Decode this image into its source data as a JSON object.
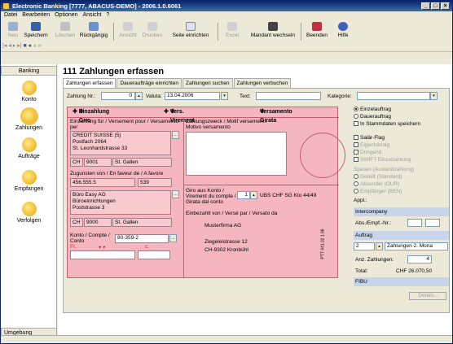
{
  "window": {
    "title": "Electronic Banking [7777, ABACUS-DEMO] - 2006.1.0.6061"
  },
  "menu": [
    "Datei",
    "Bearbeiten",
    "Optionen",
    "Ansicht",
    "?"
  ],
  "toolbar": [
    {
      "label": "Neu",
      "enabled": false
    },
    {
      "label": "Speichern",
      "enabled": true
    },
    {
      "label": "Löschen",
      "enabled": false
    },
    {
      "label": "Rückgängig",
      "enabled": true
    },
    {
      "label": "Ansicht",
      "enabled": false
    },
    {
      "label": "Drucken",
      "enabled": false
    },
    {
      "label": "Seite einrichten",
      "enabled": true
    },
    {
      "label": "Excel",
      "enabled": false
    },
    {
      "label": "Mandant wechseln",
      "enabled": true
    },
    {
      "label": "Beenden",
      "enabled": true
    },
    {
      "label": "Hilfe",
      "enabled": true
    }
  ],
  "sidebar": {
    "header": "Banking",
    "items": [
      "Konto",
      "Zahlungen",
      "Aufträge",
      "Empfangen",
      "Verfolgen"
    ],
    "selected": "Zahlungen",
    "footer": "Umgebung"
  },
  "page": {
    "title": "111 Zahlungen erfassen"
  },
  "tabs": [
    "Zahlungen erfassen",
    "Daueraufträge einrichten",
    "Zahlungen suchen",
    "Zahlungen verbuchen"
  ],
  "form": {
    "zahlung_label": "Zahlung  Nr.:",
    "zahlung_nr": "0",
    "valuta_label": "Valuta:",
    "valuta": "13.04.2006",
    "text_label": "Text:",
    "text": "",
    "kategorie_label": "Kategorie:",
    "kategorie": ""
  },
  "slip": {
    "h1": "Einzahlung Giro",
    "h2": "Vers. Virement",
    "h3": "Versamento Girata",
    "einzahlung_label": "Einzahlung für / Versement pour / Versamento per",
    "bank_line1": "CREDIT SUISSE (5)",
    "bank_line2": "Postfach 2064",
    "bank_line3": "St. Leonhardstrasse 33",
    "bank_cc": "CH",
    "bank_plz": "9001",
    "bank_ort": "St. Gallen",
    "zahlungszweck_label": "Zahlungszweck / Motif versement / Motivo versamento",
    "zugunsten_label": "Zugunsten von / En faveur de / A favore",
    "zugunsten_nr": "456.555.5",
    "zugunsten_nr2": "539",
    "empf_line1": "Büro Easy AG",
    "empf_line2": "Büroeinrichtungen",
    "empf_line3": "Poststrasse 3",
    "empf_cc": "CH",
    "empf_plz": "9000",
    "empf_ort": "St. Gallen",
    "giro_label": "Giro aus Konto / Virement du compte / Girata dal conto",
    "giro_nr": "1",
    "giro_konto": "UBS CHF SG Kto 44/49",
    "einbezahlt_label": "Einbezahlt von / Versé par / Versato da",
    "von_line1": "Musterfirma AG",
    "von_line2": "Ziegeleistrasse 12",
    "von_line3": "CH-9302 Kronbühl",
    "ptt": "PTT 441.02 1.98",
    "konto_label": "Konto / Compte / Conto",
    "konto": "80-359-2",
    "fr_label": "Fr.",
    "c_label": "c."
  },
  "right": {
    "radios1": [
      {
        "label": "Einzelauftrag",
        "on": true
      },
      {
        "label": "Dauerauftrag",
        "on": false
      }
    ],
    "in_stammdaten": "In Stammdaten speichern",
    "checks": [
      {
        "label": "Salär-Flag",
        "enabled": true
      },
      {
        "label": "Eigenhändig",
        "enabled": false
      },
      {
        "label": "Dringend",
        "enabled": false
      },
      {
        "label": "SWIFT Einzelzahlung",
        "enabled": false
      }
    ],
    "spesen_label": "Spesen (Auslandzahlung)",
    "spesen": [
      "Geteilt (Standard)",
      "Absender (OUR)",
      "Empfänger (BEN)"
    ],
    "appl_label": "Appl.:",
    "intercompany": "Intercompany",
    "abs_label": "Abs./Empf.-Nr.:",
    "auftrag": "Auftrag",
    "auftrag_nr": "2",
    "auftrag_text": "Zahlungen 2. Mona",
    "anz_label": "Anz. Zahlungen:",
    "anz": "4",
    "total_label": "Total:",
    "total": "CHF 26.070,50",
    "fibu": "FIBU",
    "details": "Details..."
  }
}
